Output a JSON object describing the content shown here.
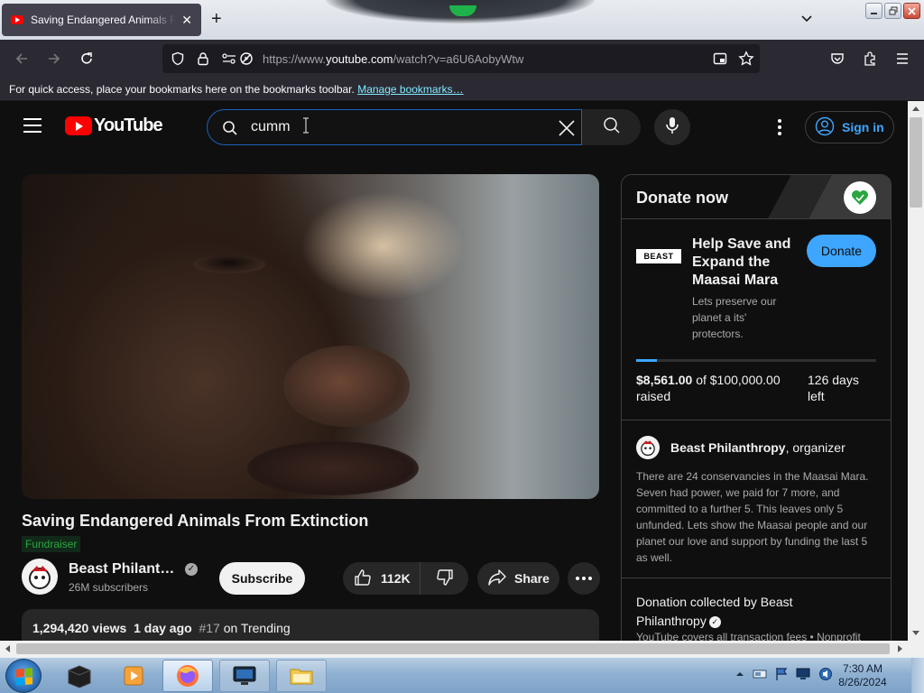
{
  "browser": {
    "tab": {
      "title": "Saving Endangered Animals From Extinction"
    },
    "url": {
      "prefix": "https://www.",
      "host": "youtube.com",
      "path": "/watch?v=a6U6AobyWtw"
    },
    "bookmarks_bar": {
      "message": "For quick access, place your bookmarks here on the bookmarks toolbar.",
      "link": "Manage bookmarks…"
    }
  },
  "youtube": {
    "logo_text": "YouTube",
    "search": {
      "value": "cumm"
    },
    "signin_label": "Sign in",
    "video": {
      "title": "Saving Endangered Animals From Extinction",
      "badge": "Fundraiser",
      "channel_name": "Beast Philanthropy",
      "subscribers": "26M subscribers",
      "subscribe_label": "Subscribe",
      "likes": "112K",
      "share_label": "Share",
      "views": "1,294,420 views",
      "date": "1 day ago",
      "trending_rank": "#17",
      "trending_label": "on Trending"
    },
    "donate": {
      "header": "Donate now",
      "cause_logo": "BEAST",
      "cause_title": "Help Save and Expand the Maasai Mara",
      "cause_subtitle": "Lets preserve our planet a its' protectors.",
      "button_label": "Donate",
      "progress_fraction": 0.0856,
      "raised_amount": "$8,561.00",
      "goal_text": "of $100,000.00 raised",
      "days_left": "126 days left",
      "organizer_name": "Beast Philanthropy",
      "organizer_role": ", organizer",
      "organizer_desc": "There are 24 conservancies in the Maasai Mara. Seven had power, we paid for 7 more, and committed to a further 5. This leaves only 5 unfunded. Lets show the Maasai people and our planet our love and support by funding the last 5 as well.",
      "collected_by": "Donation collected by Beast Philanthropy",
      "collected_note": "YouTube covers all transaction fees  •  Nonprofit"
    }
  },
  "taskbar": {
    "time": "7:30 AM",
    "date": "8/26/2024"
  },
  "colors": {
    "accent_blue": "#3ea6ff",
    "yt_red": "#ff0000",
    "fundraiser_green": "#2ba640"
  }
}
